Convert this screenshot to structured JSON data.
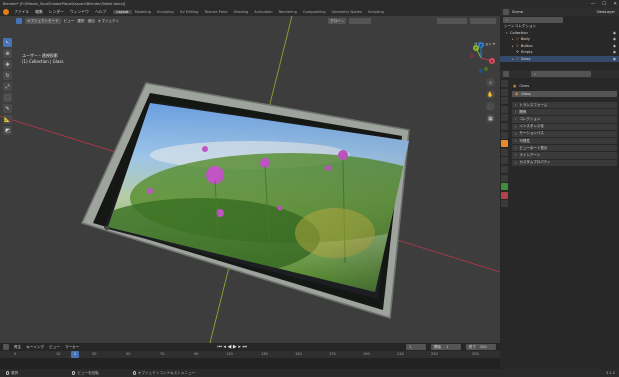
{
  "window": {
    "title": "Blender* [F:\\Mitsuki_Sora\\FutabaPlace\\Kasumi\\Blender\\Tablet.blend]",
    "controls": [
      "—",
      "☐",
      "✕"
    ]
  },
  "menubar": {
    "menus": [
      "ファイル",
      "編集",
      "レンダー",
      "ウィンドウ",
      "ヘルプ"
    ],
    "workspaces": [
      "Layout",
      "Modeling",
      "Sculpting",
      "UV Editing",
      "Texture Paint",
      "Shading",
      "Animation",
      "Rendering",
      "Compositing",
      "Geometry Nodes",
      "Scripting"
    ],
    "active_workspace": "Layout"
  },
  "viewport_header": {
    "mode": "オブジェクトモード",
    "menus": [
      "ビュー",
      "選択",
      "追加",
      "オブジェクト"
    ],
    "transform": "グロー..."
  },
  "viewport": {
    "view_name": "ユーザー・透視投影",
    "collection_info": "(1) Collection | Glass",
    "options_label": "オプション ▾",
    "gizmo": {
      "x": "X",
      "y": "Y",
      "z": "Z"
    }
  },
  "outliner": {
    "header": "Scene",
    "view_layer": "ViewLayer",
    "root": "シーンコレクション",
    "collection": "Collection",
    "items": [
      {
        "name": "Body",
        "color": "#e88a2a"
      },
      {
        "name": "Button",
        "color": "#e88a2a"
      },
      {
        "name": "Empty",
        "color": "#bbbbbb"
      },
      {
        "name": "Glass",
        "color": "#e88a2a"
      }
    ]
  },
  "properties": {
    "object_name": "Glass",
    "object_field": "Glass",
    "panels": [
      "トランスフォーム",
      "関係",
      "コレクション",
      "インスタンス化",
      "モーションパス",
      "可視性",
      "ビューポート表示",
      "ラインアート",
      "カスタムプロパティ"
    ]
  },
  "timeline": {
    "menus": [
      "再生",
      "キーイング",
      "ビュー",
      "マーカー"
    ],
    "current_frame": "1",
    "start_label": "開始",
    "start": "1",
    "end_label": "終了",
    "end": "250",
    "ruler_ticks": [
      "0",
      "10",
      "30",
      "50",
      "70",
      "90",
      "110",
      "130",
      "150",
      "170",
      "190",
      "210",
      "230",
      "250"
    ]
  },
  "statusbar": {
    "items": [
      "選択",
      "ビューを回転",
      "オブジェクトコンテキストメニュー"
    ],
    "version": "3.1.2"
  },
  "colors": {
    "accent": "#4772b3",
    "viewport_bg": "#3d3d3d",
    "panel_bg": "#282828",
    "x_axis": "#b9374a",
    "y_axis": "#8bb631",
    "frame_indicator": "#4772b3"
  }
}
